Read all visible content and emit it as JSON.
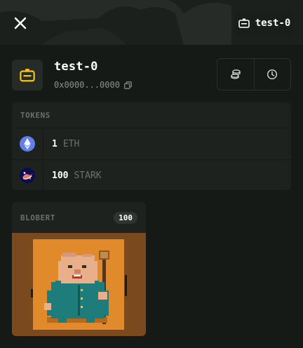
{
  "topbar": {
    "close_icon": "close-icon",
    "account_label": "test-0",
    "account_icon": "robot-icon"
  },
  "header": {
    "title": "test-0",
    "address": "0x0000...0000",
    "avatar_icon": "robot-icon",
    "copy_icon": "copy-icon",
    "actions": [
      {
        "icon": "coins-icon"
      },
      {
        "icon": "clock-icon"
      }
    ]
  },
  "tokens": {
    "heading": "TOKENS",
    "items": [
      {
        "amount": "1",
        "symbol": "ETH",
        "icon": "ethereum-icon"
      },
      {
        "amount": "100",
        "symbol": "STARK",
        "icon": "starknet-icon"
      }
    ]
  },
  "collectible": {
    "title": "BLOBERT",
    "count": "100",
    "image": "blobert-pixel-art"
  },
  "colors": {
    "background": "#161a17",
    "panel": "#1e221f",
    "accent_yellow": "#f5c518",
    "eth_blue": "#627eea",
    "stark_navy": "#0c0c4f",
    "art_orange": "#e08a2c"
  }
}
